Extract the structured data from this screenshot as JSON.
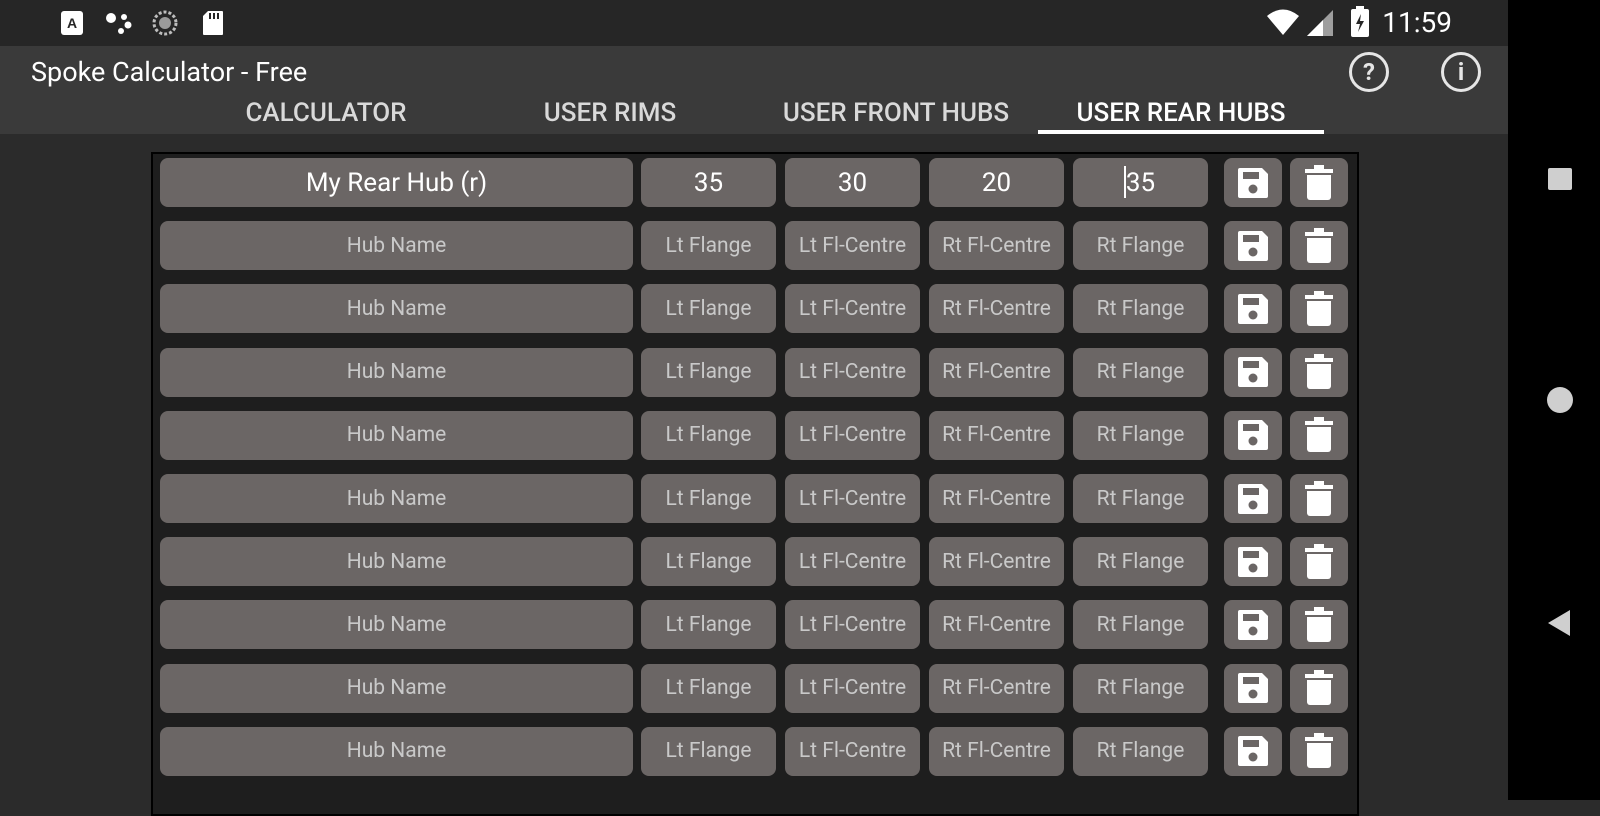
{
  "status_bar": {
    "time": "11:59",
    "left_icons": [
      "a-icon",
      "assistant-icon",
      "sync-icon",
      "sd-card-icon"
    ],
    "right_icons": [
      "wifi-icon",
      "signal-icon",
      "battery-icon"
    ]
  },
  "app": {
    "title": "Spoke Calculator - Free",
    "tabs": [
      {
        "label": "CALCULATOR",
        "active": false
      },
      {
        "label": "USER RIMS",
        "active": false
      },
      {
        "label": "USER FRONT HUBS",
        "active": false
      },
      {
        "label": "USER REAR HUBS",
        "active": true
      }
    ]
  },
  "rows": [
    {
      "name": "My Rear Hub (r)",
      "lt_flange": "35",
      "lt_fl_centre": "30",
      "rt_fl_centre": "20",
      "rt_flange": "35"
    },
    {
      "name": "",
      "lt_flange": "",
      "lt_fl_centre": "",
      "rt_fl_centre": "",
      "rt_flange": ""
    },
    {
      "name": "",
      "lt_flange": "",
      "lt_fl_centre": "",
      "rt_fl_centre": "",
      "rt_flange": ""
    },
    {
      "name": "",
      "lt_flange": "",
      "lt_fl_centre": "",
      "rt_fl_centre": "",
      "rt_flange": ""
    },
    {
      "name": "",
      "lt_flange": "",
      "lt_fl_centre": "",
      "rt_fl_centre": "",
      "rt_flange": ""
    },
    {
      "name": "",
      "lt_flange": "",
      "lt_fl_centre": "",
      "rt_fl_centre": "",
      "rt_flange": ""
    },
    {
      "name": "",
      "lt_flange": "",
      "lt_fl_centre": "",
      "rt_fl_centre": "",
      "rt_flange": ""
    },
    {
      "name": "",
      "lt_flange": "",
      "lt_fl_centre": "",
      "rt_fl_centre": "",
      "rt_flange": ""
    },
    {
      "name": "",
      "lt_flange": "",
      "lt_fl_centre": "",
      "rt_fl_centre": "",
      "rt_flange": ""
    },
    {
      "name": "",
      "lt_flange": "",
      "lt_fl_centre": "",
      "rt_fl_centre": "",
      "rt_flange": ""
    }
  ],
  "placeholders": {
    "name": "Hub Name",
    "lt_flange": "Lt Flange",
    "lt_fl_centre": "Lt Fl-Centre",
    "rt_fl_centre": "Rt Fl-Centre",
    "rt_flange": "Rt Flange"
  },
  "row_action_icons": [
    "save-icon",
    "delete-icon"
  ],
  "colors": {
    "background": "#2b2b2b",
    "app_bar": "#3a3a3a",
    "cell": "#6b6665",
    "panel": "#1e1e1e"
  }
}
